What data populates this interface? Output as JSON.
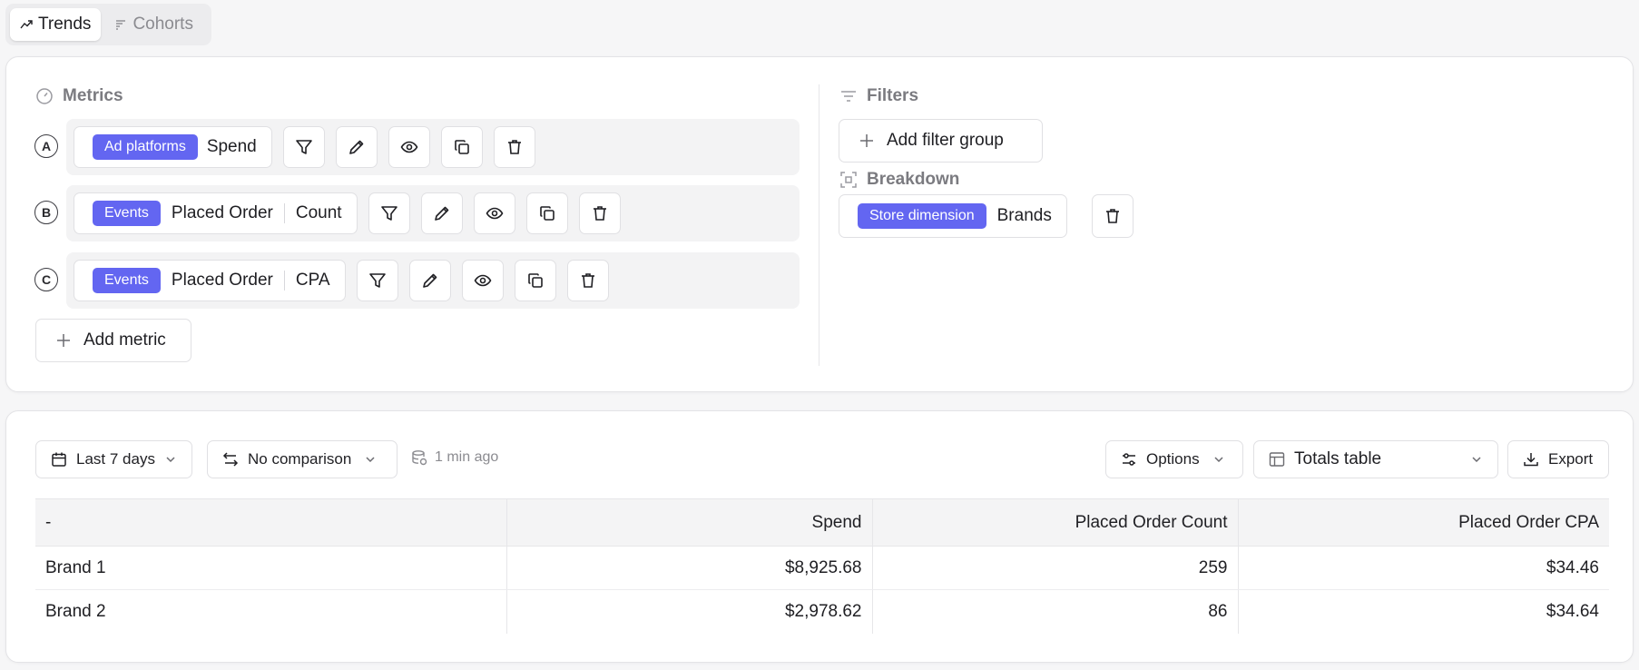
{
  "tabs": [
    {
      "label": "Trends",
      "icon": "trend-icon",
      "active": true
    },
    {
      "label": "Cohorts",
      "icon": "cohorts-icon",
      "active": false
    }
  ],
  "metrics": {
    "title": "Metrics",
    "items": [
      {
        "letter": "A",
        "tag": "Ad platforms",
        "name": "Spend",
        "agg": ""
      },
      {
        "letter": "B",
        "tag": "Events",
        "name": "Placed Order",
        "agg": "Count"
      },
      {
        "letter": "C",
        "tag": "Events",
        "name": "Placed Order",
        "agg": "CPA"
      }
    ],
    "add_label": "Add metric"
  },
  "filters": {
    "title": "Filters",
    "add_label": "Add filter group"
  },
  "breakdown": {
    "title": "Breakdown",
    "tag": "Store dimension",
    "value": "Brands"
  },
  "toolbar": {
    "date_range": "Last 7 days",
    "comparison": "No comparison",
    "refreshed": "1 min ago",
    "options": "Options",
    "view": "Totals table",
    "export": "Export"
  },
  "table": {
    "headers": [
      "-",
      "Spend",
      "Placed Order Count",
      "Placed Order CPA"
    ],
    "rows": [
      [
        "Brand 1",
        "$8,925.68",
        "259",
        "$34.46"
      ],
      [
        "Brand 2",
        "$2,978.62",
        "86",
        "$34.64"
      ]
    ]
  },
  "colors": {
    "accent": "#6366f1",
    "background": "#f6f6f7"
  }
}
